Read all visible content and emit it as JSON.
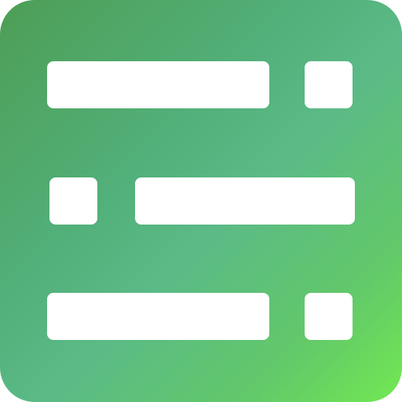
{
  "icon": {
    "name": "list-settings-icon",
    "colors": {
      "gradient_start": "#4d9e55",
      "gradient_mid": "#5bba86",
      "gradient_end": "#72e852",
      "glyph": "#ffffff"
    },
    "rows": [
      {
        "order": [
          "bar",
          "square"
        ]
      },
      {
        "order": [
          "square",
          "bar"
        ]
      },
      {
        "order": [
          "bar",
          "square"
        ]
      }
    ]
  }
}
